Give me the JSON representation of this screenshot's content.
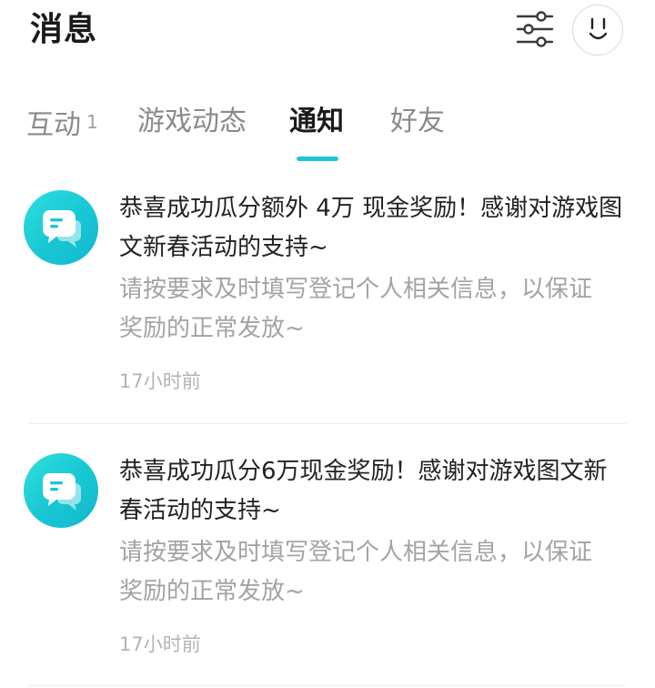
{
  "header": {
    "title": "消息",
    "filter_icon": "sliders-icon",
    "avatar_icon": "smiley-icon"
  },
  "tabs": [
    {
      "label": "互动",
      "badge": "1"
    },
    {
      "label": "游戏动态"
    },
    {
      "label": "通知",
      "active": true
    },
    {
      "label": "好友"
    }
  ],
  "accent_color": "#1cc7cf",
  "messages": [
    {
      "icon": "chat-bubble-icon",
      "title": "恭喜成功瓜分额外 4万 现金奖励！感谢对游戏图文新春活动的支持~",
      "body": "请按要求及时填写登记个人相关信息，以保证奖励的正常发放~",
      "time": "17小时前"
    },
    {
      "icon": "chat-bubble-icon",
      "title": "恭喜成功瓜分6万现金奖励！感谢对游戏图文新春活动的支持~",
      "body": "请按要求及时填写登记个人相关信息，以保证奖励的正常发放~",
      "time": "17小时前"
    }
  ]
}
